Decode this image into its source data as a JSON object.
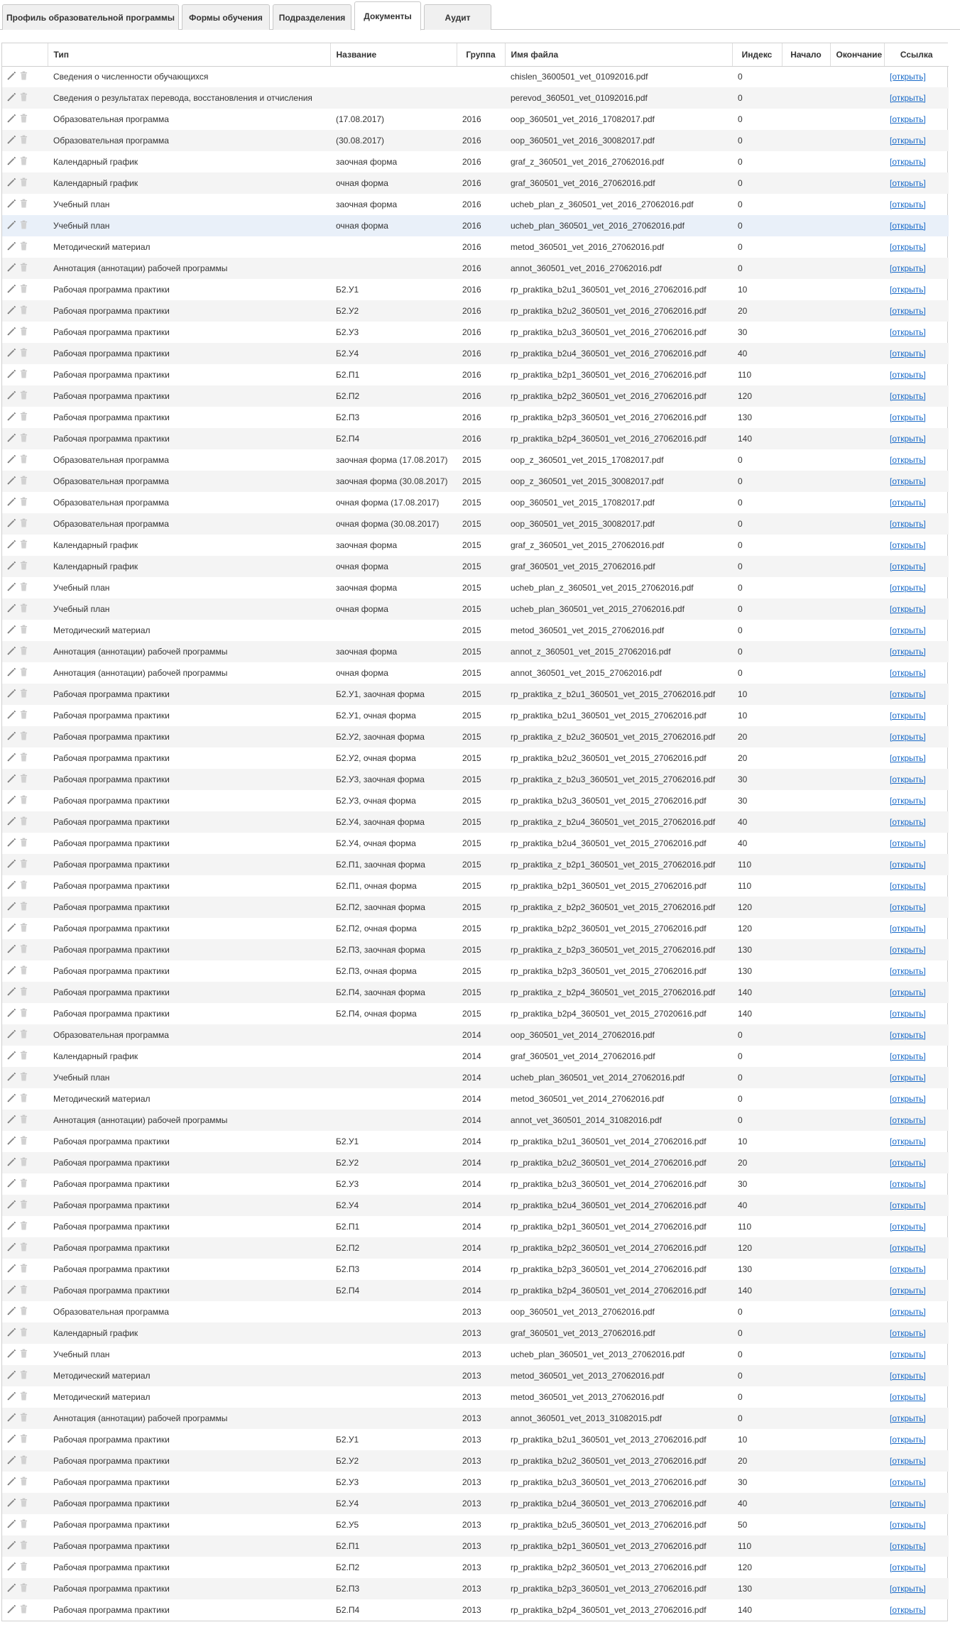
{
  "tabs": [
    {
      "label": "Профиль образовательной программы",
      "active": false
    },
    {
      "label": "Формы обучения",
      "active": false
    },
    {
      "label": "Подразделения",
      "active": false
    },
    {
      "label": "Документы",
      "active": true
    },
    {
      "label": "Аудит",
      "active": false
    }
  ],
  "icons": {
    "edit": "pencil-icon",
    "delete": "trash-icon"
  },
  "colors": {
    "link": "#1a6bc9",
    "stripe": "#f4f4f4",
    "highlight": "#e9f0f9"
  },
  "table": {
    "columns": [
      "",
      "Тип",
      "Название",
      "Группа",
      "Имя файла",
      "Индекс",
      "Начало",
      "Окончание",
      "Ссылка"
    ],
    "link_label": "[открыть]",
    "highlight_row": 7,
    "rows": [
      [
        "Сведения о численности обучающихся",
        "",
        "",
        "chislen_3600501_vet_01092016.pdf",
        "0"
      ],
      [
        "Сведения о результатах перевода, восстановления и отчисления",
        "",
        "",
        "perevod_360501_vet_01092016.pdf",
        "0"
      ],
      [
        "Образовательная программа",
        "(17.08.2017)",
        "2016",
        "oop_360501_vet_2016_17082017.pdf",
        "0"
      ],
      [
        "Образовательная программа",
        "(30.08.2017)",
        "2016",
        "oop_360501_vet_2016_30082017.pdf",
        "0"
      ],
      [
        "Календарный график",
        "заочная форма",
        "2016",
        "graf_z_360501_vet_2016_27062016.pdf",
        "0"
      ],
      [
        "Календарный график",
        "очная форма",
        "2016",
        "graf_360501_vet_2016_27062016.pdf",
        "0"
      ],
      [
        "Учебный план",
        "заочная форма",
        "2016",
        "ucheb_plan_z_360501_vet_2016_27062016.pdf",
        "0"
      ],
      [
        "Учебный план",
        "очная форма",
        "2016",
        "ucheb_plan_360501_vet_2016_27062016.pdf",
        "0"
      ],
      [
        "Методический материал",
        "",
        "2016",
        "metod_360501_vet_2016_27062016.pdf",
        "0"
      ],
      [
        "Аннотация (аннотации) рабочей программы",
        "",
        "2016",
        "annot_360501_vet_2016_27062016.pdf",
        "0"
      ],
      [
        "Рабочая программа практики",
        "Б2.У1",
        "2016",
        "rp_praktika_b2u1_360501_vet_2016_27062016.pdf",
        "10"
      ],
      [
        "Рабочая программа практики",
        "Б2.У2",
        "2016",
        "rp_praktika_b2u2_360501_vet_2016_27062016.pdf",
        "20"
      ],
      [
        "Рабочая программа практики",
        "Б2.У3",
        "2016",
        "rp_praktika_b2u3_360501_vet_2016_27062016.pdf",
        "30"
      ],
      [
        "Рабочая программа практики",
        "Б2.У4",
        "2016",
        "rp_praktika_b2u4_360501_vet_2016_27062016.pdf",
        "40"
      ],
      [
        "Рабочая программа практики",
        "Б2.П1",
        "2016",
        "rp_praktika_b2p1_360501_vet_2016_27062016.pdf",
        "110"
      ],
      [
        "Рабочая программа практики",
        "Б2.П2",
        "2016",
        "rp_praktika_b2p2_360501_vet_2016_27062016.pdf",
        "120"
      ],
      [
        "Рабочая программа практики",
        "Б2.П3",
        "2016",
        "rp_praktika_b2p3_360501_vet_2016_27062016.pdf",
        "130"
      ],
      [
        "Рабочая программа практики",
        "Б2.П4",
        "2016",
        "rp_praktika_b2p4_360501_vet_2016_27062016.pdf",
        "140"
      ],
      [
        "Образовательная программа",
        "заочная форма (17.08.2017)",
        "2015",
        "oop_z_360501_vet_2015_17082017.pdf",
        "0"
      ],
      [
        "Образовательная программа",
        "заочная форма (30.08.2017)",
        "2015",
        "oop_z_360501_vet_2015_30082017.pdf",
        "0"
      ],
      [
        "Образовательная программа",
        "очная форма (17.08.2017)",
        "2015",
        "oop_360501_vet_2015_17082017.pdf",
        "0"
      ],
      [
        "Образовательная программа",
        "очная форма (30.08.2017)",
        "2015",
        "oop_360501_vet_2015_30082017.pdf",
        "0"
      ],
      [
        "Календарный график",
        "заочная форма",
        "2015",
        "graf_z_360501_vet_2015_27062016.pdf",
        "0"
      ],
      [
        "Календарный график",
        "очная форма",
        "2015",
        "graf_360501_vet_2015_27062016.pdf",
        "0"
      ],
      [
        "Учебный план",
        "заочная форма",
        "2015",
        "ucheb_plan_z_360501_vet_2015_27062016.pdf",
        "0"
      ],
      [
        "Учебный план",
        "очная форма",
        "2015",
        "ucheb_plan_360501_vet_2015_27062016.pdf",
        "0"
      ],
      [
        "Методический материал",
        "",
        "2015",
        "metod_360501_vet_2015_27062016.pdf",
        "0"
      ],
      [
        "Аннотация (аннотации) рабочей программы",
        "заочная форма",
        "2015",
        "annot_z_360501_vet_2015_27062016.pdf",
        "0"
      ],
      [
        "Аннотация (аннотации) рабочей программы",
        "очная форма",
        "2015",
        "annot_360501_vet_2015_27062016.pdf",
        "0"
      ],
      [
        "Рабочая программа практики",
        "Б2.У1, заочная форма",
        "2015",
        "rp_praktika_z_b2u1_360501_vet_2015_27062016.pdf",
        "10"
      ],
      [
        "Рабочая программа практики",
        "Б2.У1, очная форма",
        "2015",
        "rp_praktika_b2u1_360501_vet_2015_27062016.pdf",
        "10"
      ],
      [
        "Рабочая программа практики",
        "Б2.У2, заочная форма",
        "2015",
        "rp_praktika_z_b2u2_360501_vet_2015_27062016.pdf",
        "20"
      ],
      [
        "Рабочая программа практики",
        "Б2.У2, очная форма",
        "2015",
        "rp_praktika_b2u2_360501_vet_2015_27062016.pdf",
        "20"
      ],
      [
        "Рабочая программа практики",
        "Б2.У3, заочная форма",
        "2015",
        "rp_praktika_z_b2u3_360501_vet_2015_27062016.pdf",
        "30"
      ],
      [
        "Рабочая программа практики",
        "Б2.У3, очная форма",
        "2015",
        "rp_praktika_b2u3_360501_vet_2015_27062016.pdf",
        "30"
      ],
      [
        "Рабочая программа практики",
        "Б2.У4, заочная форма",
        "2015",
        "rp_praktika_z_b2u4_360501_vet_2015_27062016.pdf",
        "40"
      ],
      [
        "Рабочая программа практики",
        "Б2.У4, очная форма",
        "2015",
        "rp_praktika_b2u4_360501_vet_2015_27062016.pdf",
        "40"
      ],
      [
        "Рабочая программа практики",
        "Б2.П1, заочная форма",
        "2015",
        "rp_praktika_z_b2p1_360501_vet_2015_27062016.pdf",
        "110"
      ],
      [
        "Рабочая программа практики",
        "Б2.П1, очная форма",
        "2015",
        "rp_praktika_b2p1_360501_vet_2015_27062016.pdf",
        "110"
      ],
      [
        "Рабочая программа практики",
        "Б2.П2, заочная форма",
        "2015",
        "rp_praktika_z_b2p2_360501_vet_2015_27062016.pdf",
        "120"
      ],
      [
        "Рабочая программа практики",
        "Б2.П2, очная форма",
        "2015",
        "rp_praktika_b2p2_360501_vet_2015_27062016.pdf",
        "120"
      ],
      [
        "Рабочая программа практики",
        "Б2.П3, заочная форма",
        "2015",
        "rp_praktika_z_b2p3_360501_vet_2015_27062016.pdf",
        "130"
      ],
      [
        "Рабочая программа практики",
        "Б2.П3, очная форма",
        "2015",
        "rp_praktika_b2p3_360501_vet_2015_27062016.pdf",
        "130"
      ],
      [
        "Рабочая программа практики",
        "Б2.П4, заочная форма",
        "2015",
        "rp_praktika_z_b2p4_360501_vet_2015_27062016.pdf",
        "140"
      ],
      [
        "Рабочая программа практики",
        "Б2.П4, очная форма",
        "2015",
        "rp_praktika_b2p4_360501_vet_2015_27020616.pdf",
        "140"
      ],
      [
        "Образовательная программа",
        "",
        "2014",
        "oop_360501_vet_2014_27062016.pdf",
        "0"
      ],
      [
        "Календарный график",
        "",
        "2014",
        "graf_360501_vet_2014_27062016.pdf",
        "0"
      ],
      [
        "Учебный план",
        "",
        "2014",
        "ucheb_plan_360501_vet_2014_27062016.pdf",
        "0"
      ],
      [
        "Методический материал",
        "",
        "2014",
        "metod_360501_vet_2014_27062016.pdf",
        "0"
      ],
      [
        "Аннотация (аннотации) рабочей программы",
        "",
        "2014",
        "annot_vet_360501_2014_31082016.pdf",
        "0"
      ],
      [
        "Рабочая программа практики",
        "Б2.У1",
        "2014",
        "rp_praktika_b2u1_360501_vet_2014_27062016.pdf",
        "10"
      ],
      [
        "Рабочая программа практики",
        "Б2.У2",
        "2014",
        "rp_praktika_b2u2_360501_vet_2014_27062016.pdf",
        "20"
      ],
      [
        "Рабочая программа практики",
        "Б2.У3",
        "2014",
        "rp_praktika_b2u3_360501_vet_2014_27062016.pdf",
        "30"
      ],
      [
        "Рабочая программа практики",
        "Б2.У4",
        "2014",
        "rp_praktika_b2u4_360501_vet_2014_27062016.pdf",
        "40"
      ],
      [
        "Рабочая программа практики",
        "Б2.П1",
        "2014",
        "rp_praktika_b2p1_360501_vet_2014_27062016.pdf",
        "110"
      ],
      [
        "Рабочая программа практики",
        "Б2.П2",
        "2014",
        "rp_praktika_b2p2_360501_vet_2014_27062016.pdf",
        "120"
      ],
      [
        "Рабочая программа практики",
        "Б2.П3",
        "2014",
        "rp_praktika_b2p3_360501_vet_2014_27062016.pdf",
        "130"
      ],
      [
        "Рабочая программа практики",
        "Б2.П4",
        "2014",
        "rp_praktika_b2p4_360501_vet_2014_27062016.pdf",
        "140"
      ],
      [
        "Образовательная программа",
        "",
        "2013",
        "oop_360501_vet_2013_27062016.pdf",
        "0"
      ],
      [
        "Календарный график",
        "",
        "2013",
        "graf_360501_vet_2013_27062016.pdf",
        "0"
      ],
      [
        "Учебный план",
        "",
        "2013",
        "ucheb_plan_360501_vet_2013_27062016.pdf",
        "0"
      ],
      [
        "Методический материал",
        "",
        "2013",
        "metod_360501_vet_2013_27062016.pdf",
        "0"
      ],
      [
        "Методический материал",
        "",
        "2013",
        "metod_360501_vet_2013_27062016.pdf",
        "0"
      ],
      [
        "Аннотация (аннотации) рабочей программы",
        "",
        "2013",
        "annot_360501_vet_2013_31082015.pdf",
        "0"
      ],
      [
        "Рабочая программа практики",
        "Б2.У1",
        "2013",
        "rp_praktika_b2u1_360501_vet_2013_27062016.pdf",
        "10"
      ],
      [
        "Рабочая программа практики",
        "Б2.У2",
        "2013",
        "rp_praktika_b2u2_360501_vet_2013_27062016.pdf",
        "20"
      ],
      [
        "Рабочая программа практики",
        "Б2.У3",
        "2013",
        "rp_praktika_b2u3_360501_vet_2013_27062016.pdf",
        "30"
      ],
      [
        "Рабочая программа практики",
        "Б2.У4",
        "2013",
        "rp_praktika_b2u4_360501_vet_2013_27062016.pdf",
        "40"
      ],
      [
        "Рабочая программа практики",
        "Б2.У5",
        "2013",
        "rp_praktika_b2u5_360501_vet_2013_27062016.pdf",
        "50"
      ],
      [
        "Рабочая программа практики",
        "Б2.П1",
        "2013",
        "rp_praktika_b2p1_360501_vet_2013_27062016.pdf",
        "110"
      ],
      [
        "Рабочая программа практики",
        "Б2.П2",
        "2013",
        "rp_praktika_b2p2_360501_vet_2013_27062016.pdf",
        "120"
      ],
      [
        "Рабочая программа практики",
        "Б2.П3",
        "2013",
        "rp_praktika_b2p3_360501_vet_2013_27062016.pdf",
        "130"
      ],
      [
        "Рабочая программа практики",
        "Б2.П4",
        "2013",
        "rp_praktika_b2p4_360501_vet_2013_27062016.pdf",
        "140"
      ]
    ]
  }
}
